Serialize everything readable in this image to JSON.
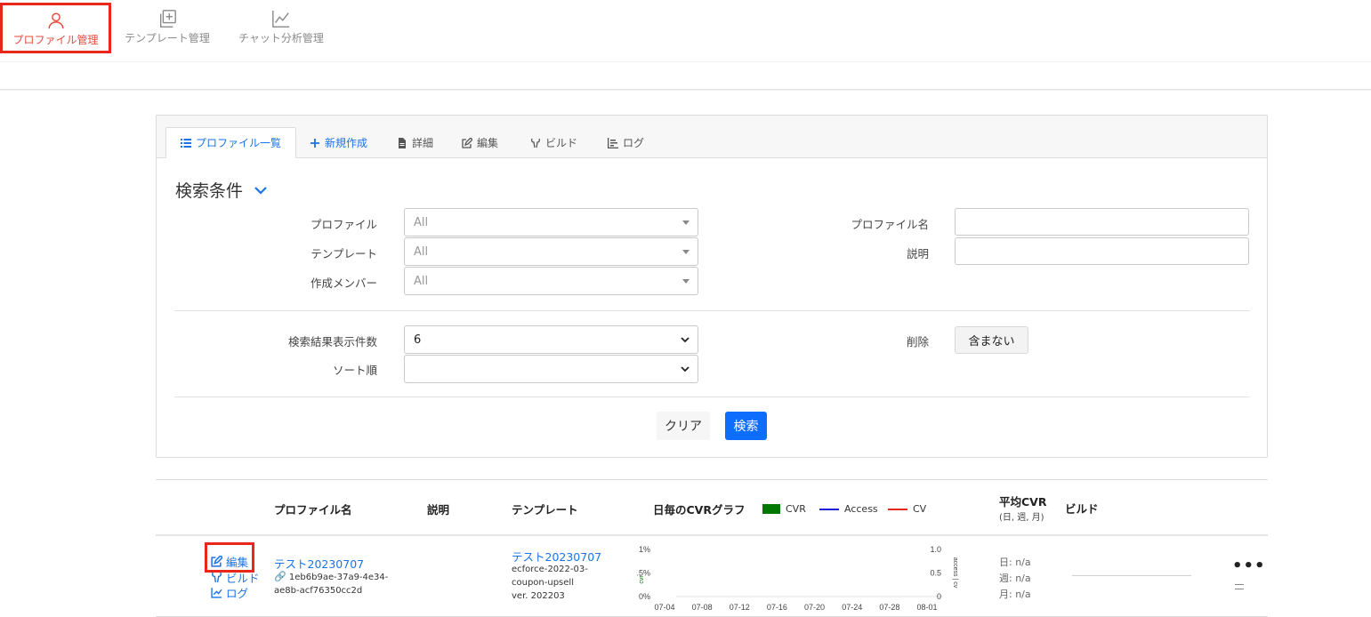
{
  "nav": {
    "items": [
      {
        "label": "プロファイル管理",
        "icon": "user-icon",
        "active": true
      },
      {
        "label": "テンプレート管理",
        "icon": "add-template-icon",
        "active": false
      },
      {
        "label": "チャット分析管理",
        "icon": "line-chart-icon",
        "active": false
      }
    ]
  },
  "tabs": {
    "list": "プロファイル一覧",
    "new": "新規作成",
    "detail": "詳細",
    "edit": "編集",
    "build": "ビルド",
    "log": "ログ"
  },
  "search": {
    "title": "検索条件",
    "profile_label": "プロファイル",
    "profile_value": "All",
    "template_label": "テンプレート",
    "template_value": "All",
    "member_label": "作成メンバー",
    "member_value": "All",
    "profile_name_label": "プロファイル名",
    "description_label": "説明",
    "results_label": "検索結果表示件数",
    "results_value": "6",
    "sort_label": "ソート順",
    "sort_value": "",
    "delete_label": "削除",
    "delete_value": "含まない",
    "clear_button": "クリア",
    "search_button": "検索"
  },
  "table": {
    "headers": {
      "profile_name": "プロファイル名",
      "description": "説明",
      "template": "テンプレート",
      "daily_cvr": "日毎のCVRグラフ",
      "avg_cvr": "平均CVR",
      "avg_cvr_sub": "(日, 週, 月)",
      "build": "ビルド"
    },
    "legend": [
      {
        "name": "CVR",
        "color": "#007700"
      },
      {
        "name": "Access",
        "color": "#1f1fd9"
      },
      {
        "name": "CV",
        "color": "#e8261a"
      }
    ],
    "row": {
      "action_edit": "編集",
      "action_build": "ビルド",
      "action_log": "ログ",
      "profile_name": "テスト20230707",
      "profile_id_1": "1eb6b9ae-37a9-4e34-",
      "profile_id_2": "ae8b-acf76350cc2d",
      "template_name": "テスト20230707",
      "template_sub_1": "ecforce-2022-03-",
      "template_sub_2": "coupon-upsell",
      "template_version": "ver. 202203",
      "avg_day": "日: n/a",
      "avg_week": "週: n/a",
      "avg_month": "月: n/a",
      "more": "•••"
    }
  },
  "chart_data": {
    "type": "line",
    "x": [
      "07-04",
      "07-08",
      "07-12",
      "07-16",
      "07-20",
      "07-24",
      "07-28",
      "08-01"
    ],
    "left_axis_label": "cvr",
    "left_ticks": [
      "1%",
      "0.5%",
      "0%"
    ],
    "right_axis_label": "access | cv",
    "right_ticks": [
      "1.0",
      "0.5",
      "0"
    ],
    "ylim_left": [
      0,
      1
    ],
    "ylim_right": [
      0,
      1
    ],
    "series": [],
    "grid": false
  }
}
